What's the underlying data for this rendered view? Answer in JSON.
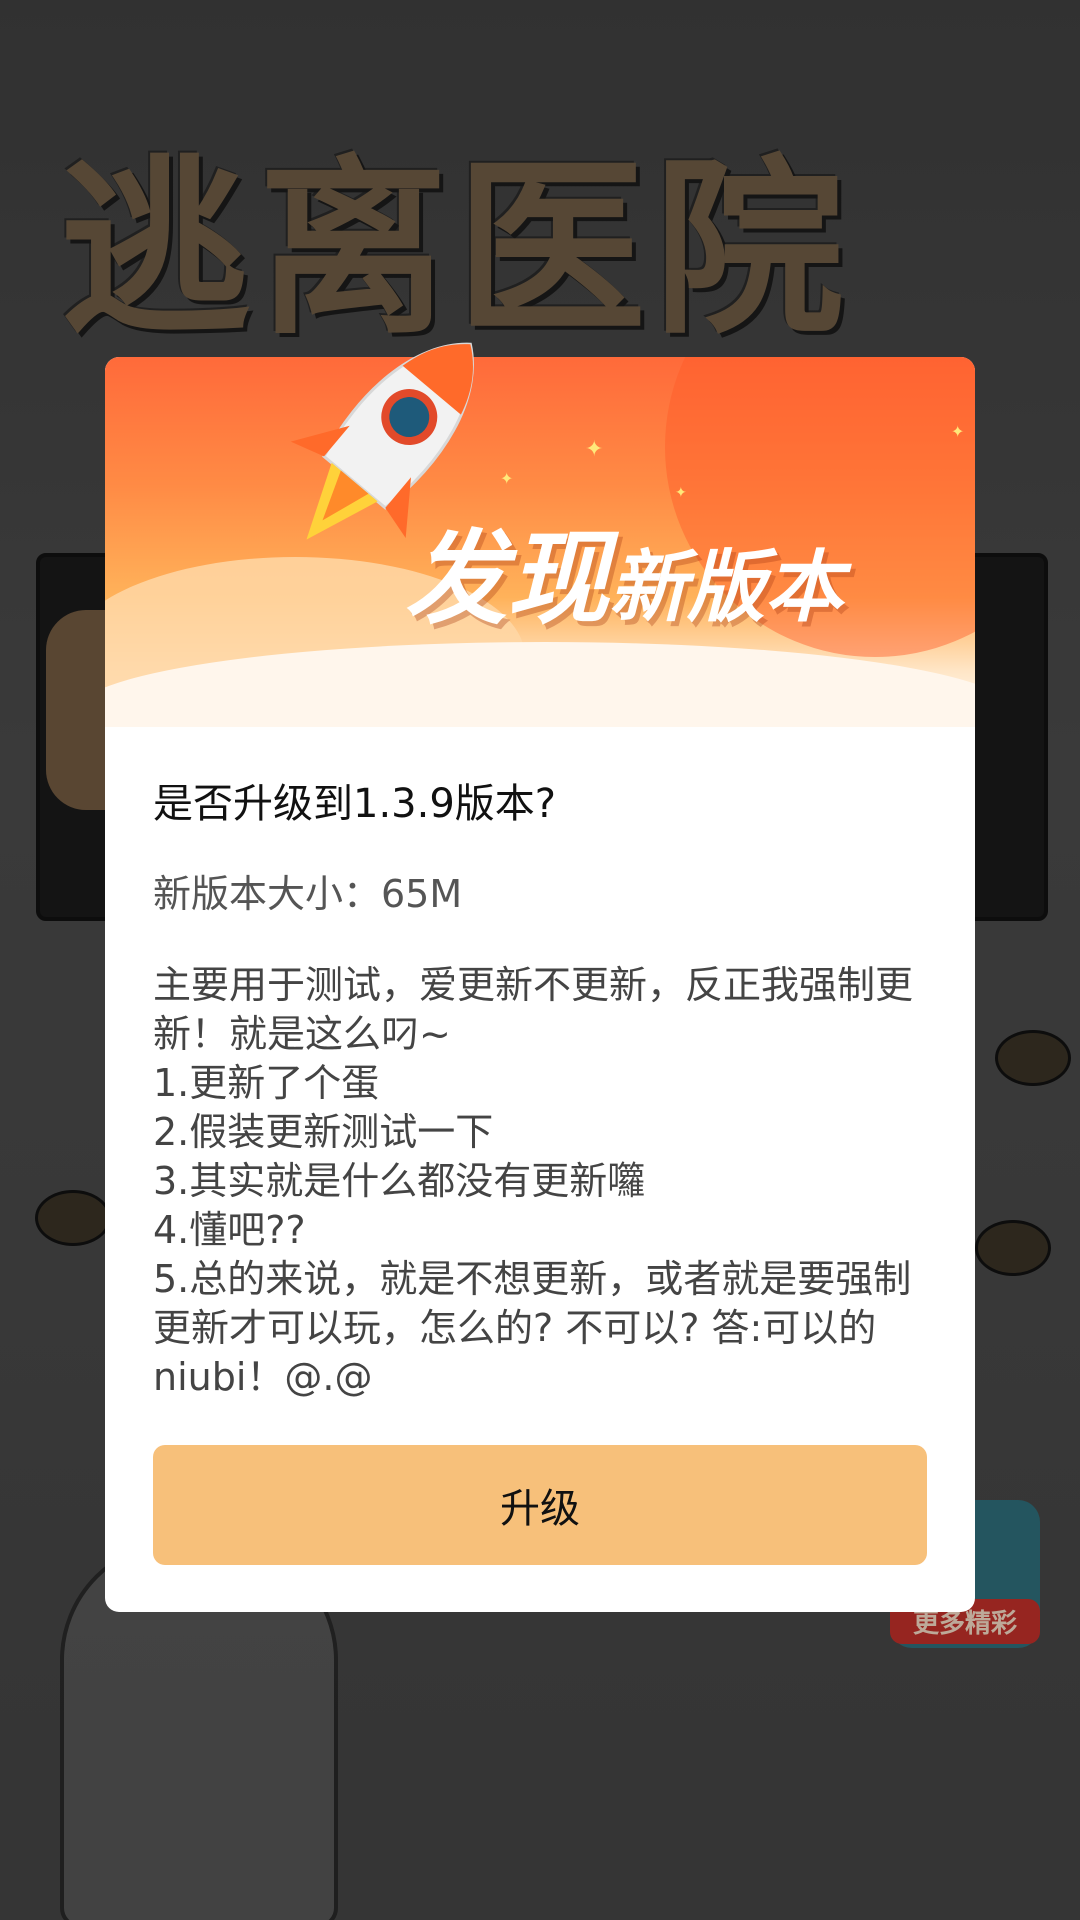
{
  "background": {
    "game_title": "逃离医院",
    "more_badge_label": "更多精彩"
  },
  "dialog": {
    "banner_title_big": "发现",
    "banner_title_small": "新版本",
    "question": "是否升级到1.3.9版本?",
    "size_label": "新版本大小：65M",
    "notes": [
      "主要用于测试，爱更新不更新，反正我强制更新！就是这么叼~",
      "1.更新了个蛋",
      "2.假装更新测试一下",
      "3.其实就是什么都没有更新囖",
      "4.懂吧??",
      "5.总的来说，就是不想更新，或者就是要强制更新才可以玩，怎么的? 不可以? 答:可以的 niubi！@.@"
    ],
    "upgrade_label": "升级"
  },
  "colors": {
    "banner_orange": "#ff6a3a",
    "button_bg": "#f7c07a",
    "dialog_bg": "#ffffff"
  },
  "icons": [
    "rocket-icon",
    "sparkle-icon"
  ]
}
